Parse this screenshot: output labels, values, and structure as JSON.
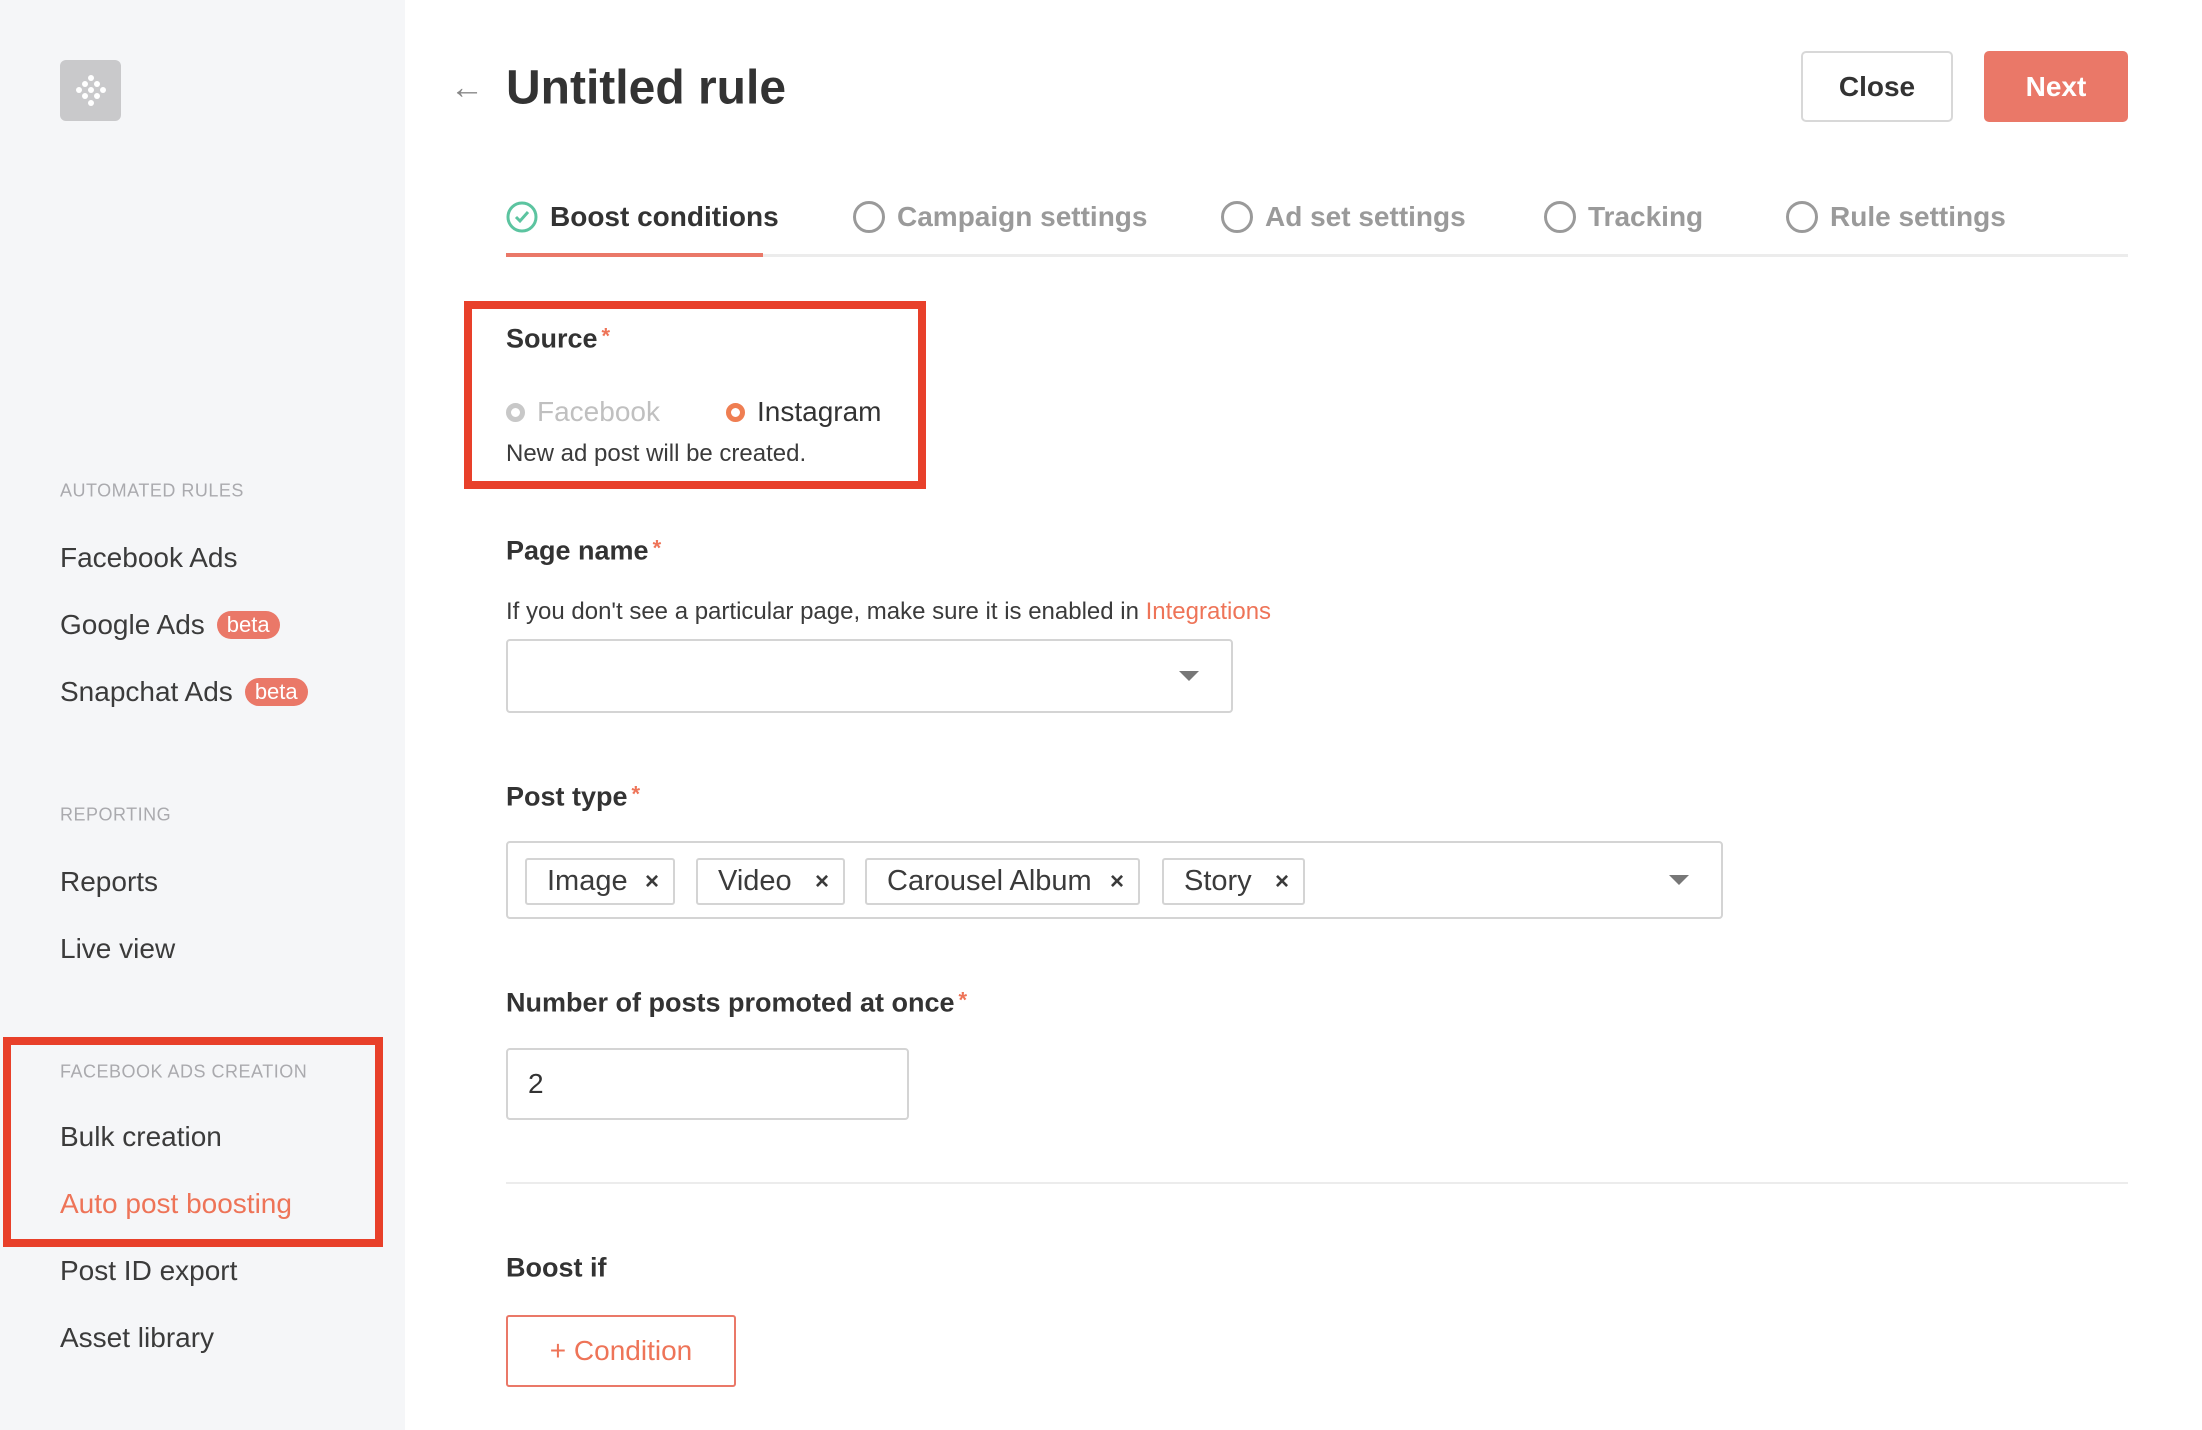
{
  "sidebar": {
    "logo_icon": "grid-diamond-logo",
    "sections": [
      {
        "title": "AUTOMATED RULES",
        "items": [
          {
            "label": "Facebook Ads"
          },
          {
            "label": "Google Ads",
            "badge": "beta"
          },
          {
            "label": "Snapchat Ads",
            "badge": "beta"
          }
        ]
      },
      {
        "title": "REPORTING",
        "items": [
          {
            "label": "Reports"
          },
          {
            "label": "Live view"
          }
        ]
      },
      {
        "title": "FACEBOOK ADS CREATION",
        "items": [
          {
            "label": "Bulk creation"
          },
          {
            "label": "Auto post boosting",
            "active": true
          },
          {
            "label": "Post ID export"
          },
          {
            "label": "Asset library"
          }
        ]
      }
    ]
  },
  "header": {
    "title": "Untitled rule",
    "close_label": "Close",
    "next_label": "Next"
  },
  "tabs": [
    {
      "label": "Boost conditions",
      "state": "complete"
    },
    {
      "label": "Campaign settings",
      "state": "pending"
    },
    {
      "label": "Ad set settings",
      "state": "pending"
    },
    {
      "label": "Tracking",
      "state": "pending"
    },
    {
      "label": "Rule settings",
      "state": "pending"
    }
  ],
  "form": {
    "source": {
      "label": "Source",
      "required": "*",
      "options": [
        "Facebook",
        "Instagram"
      ],
      "selected": "Instagram",
      "note": "New ad post will be created."
    },
    "page_name": {
      "label": "Page name",
      "required": "*",
      "help": "If you don't see a particular page, make sure it is enabled in ",
      "help_link": "Integrations",
      "value": ""
    },
    "post_type": {
      "label": "Post type",
      "required": "*",
      "tags": [
        "Image",
        "Video",
        "Carousel Album",
        "Story"
      ]
    },
    "posts_at_once": {
      "label": "Number of posts promoted at once",
      "required": "*",
      "value": "2"
    },
    "boost_if": {
      "label": "Boost if",
      "add_condition_label": "+ Condition"
    }
  },
  "colors": {
    "accent": "#ea7868",
    "link": "#ee7458",
    "success": "#5cc4a0",
    "highlight": "#e8402a"
  }
}
